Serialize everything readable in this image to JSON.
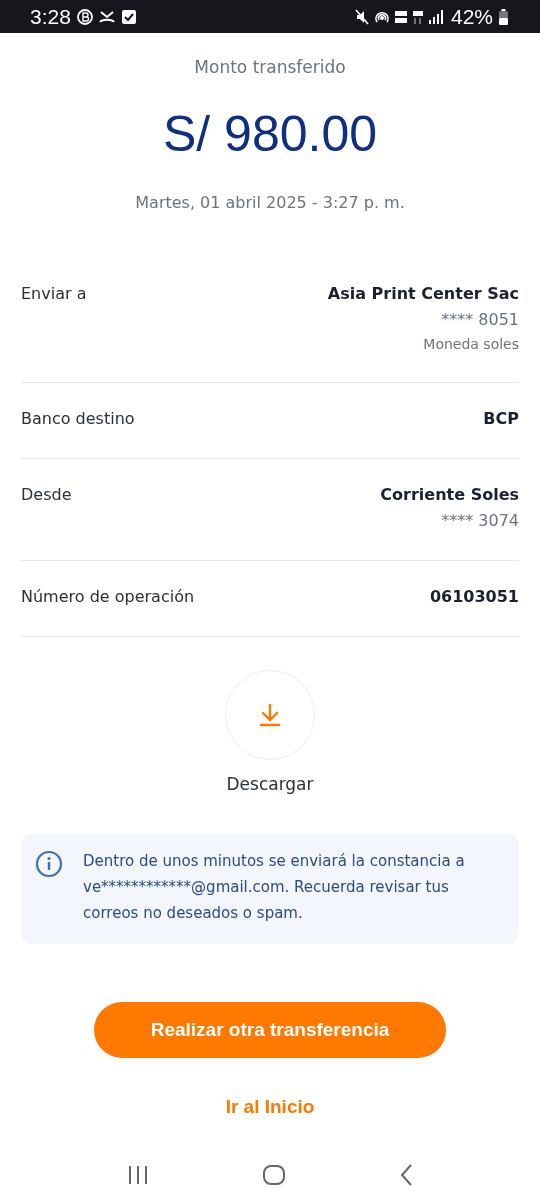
{
  "status_bar": {
    "time": "3:28",
    "battery": "42%"
  },
  "amount": {
    "label": "Monto transferido",
    "value": "S/ 980.00",
    "date": "Martes, 01 abril 2025 - 3:27 p. m."
  },
  "details": [
    {
      "label": "Enviar a",
      "lines": [
        {
          "text": "Asia Print Center Sac",
          "kind": "main"
        },
        {
          "text": "**** 8051",
          "kind": "sub"
        },
        {
          "text": "Moneda soles",
          "kind": "note"
        }
      ]
    },
    {
      "label": "Banco destino",
      "lines": [
        {
          "text": "BCP",
          "kind": "main"
        }
      ]
    },
    {
      "label": "Desde",
      "lines": [
        {
          "text": "Corriente Soles",
          "kind": "main"
        },
        {
          "text": "**** 3074",
          "kind": "sub"
        }
      ]
    },
    {
      "label": "Número de operación",
      "lines": [
        {
          "text": "06103051",
          "kind": "main"
        }
      ]
    }
  ],
  "download": {
    "label": "Descargar"
  },
  "info": "Dentro de unos minutos se enviará la constancia a ve************@gmail.com. Recuerda revisar tus correos no deseados o spam.",
  "buttons": {
    "primary": "Realizar otra transferencia",
    "link": "Ir al Inicio"
  }
}
